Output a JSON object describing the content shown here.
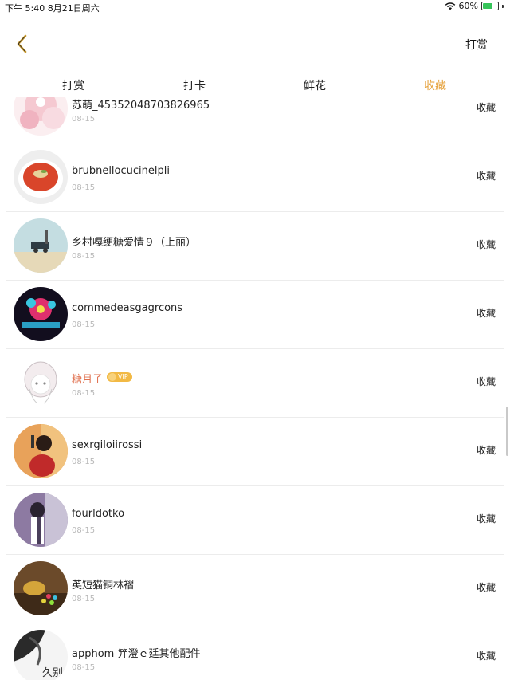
{
  "status_bar": {
    "time_date": "下午 5:40   8月21日周六",
    "battery_text": "60%",
    "battery_level": 0.6
  },
  "nav": {
    "right_action": "打赏"
  },
  "tabs": [
    {
      "label": "打赏",
      "active": false
    },
    {
      "label": "打卡",
      "active": false
    },
    {
      "label": "鲜花",
      "active": false
    },
    {
      "label": "收藏",
      "active": true
    }
  ],
  "items": [
    {
      "name": "苏萌_45352048703826965",
      "date": "08-15",
      "action": "收藏"
    },
    {
      "name": "brubnellocucinelpli",
      "date": "08-15",
      "action": "收藏"
    },
    {
      "name": "乡村嘎绠糖爱情９（上丽）",
      "date": "08-15",
      "action": "收藏"
    },
    {
      "name": "commedeasgagrcons",
      "date": "08-15",
      "action": "收藏"
    },
    {
      "name": "糖月子",
      "date": "08-15",
      "action": "收藏",
      "vip": "VIP"
    },
    {
      "name": "sexrgiloiirossi",
      "date": "08-15",
      "action": "收藏"
    },
    {
      "name": "fourldotko",
      "date": "08-15",
      "action": "收藏"
    },
    {
      "name": "英短猫铜林褶",
      "date": "08-15",
      "action": "收藏"
    },
    {
      "name": "apphom 笄澄ｅ廷其他配件",
      "date": "08-15",
      "action": "收藏",
      "avatar_text": "久别"
    }
  ],
  "colors": {
    "accent": "#e6a23c",
    "vip_name": "#e0704e",
    "date_gray": "#b8b8b8"
  },
  "icons": {
    "back": "chevron-left-icon",
    "wifi": "wifi-icon",
    "battery": "battery-charging-icon"
  }
}
